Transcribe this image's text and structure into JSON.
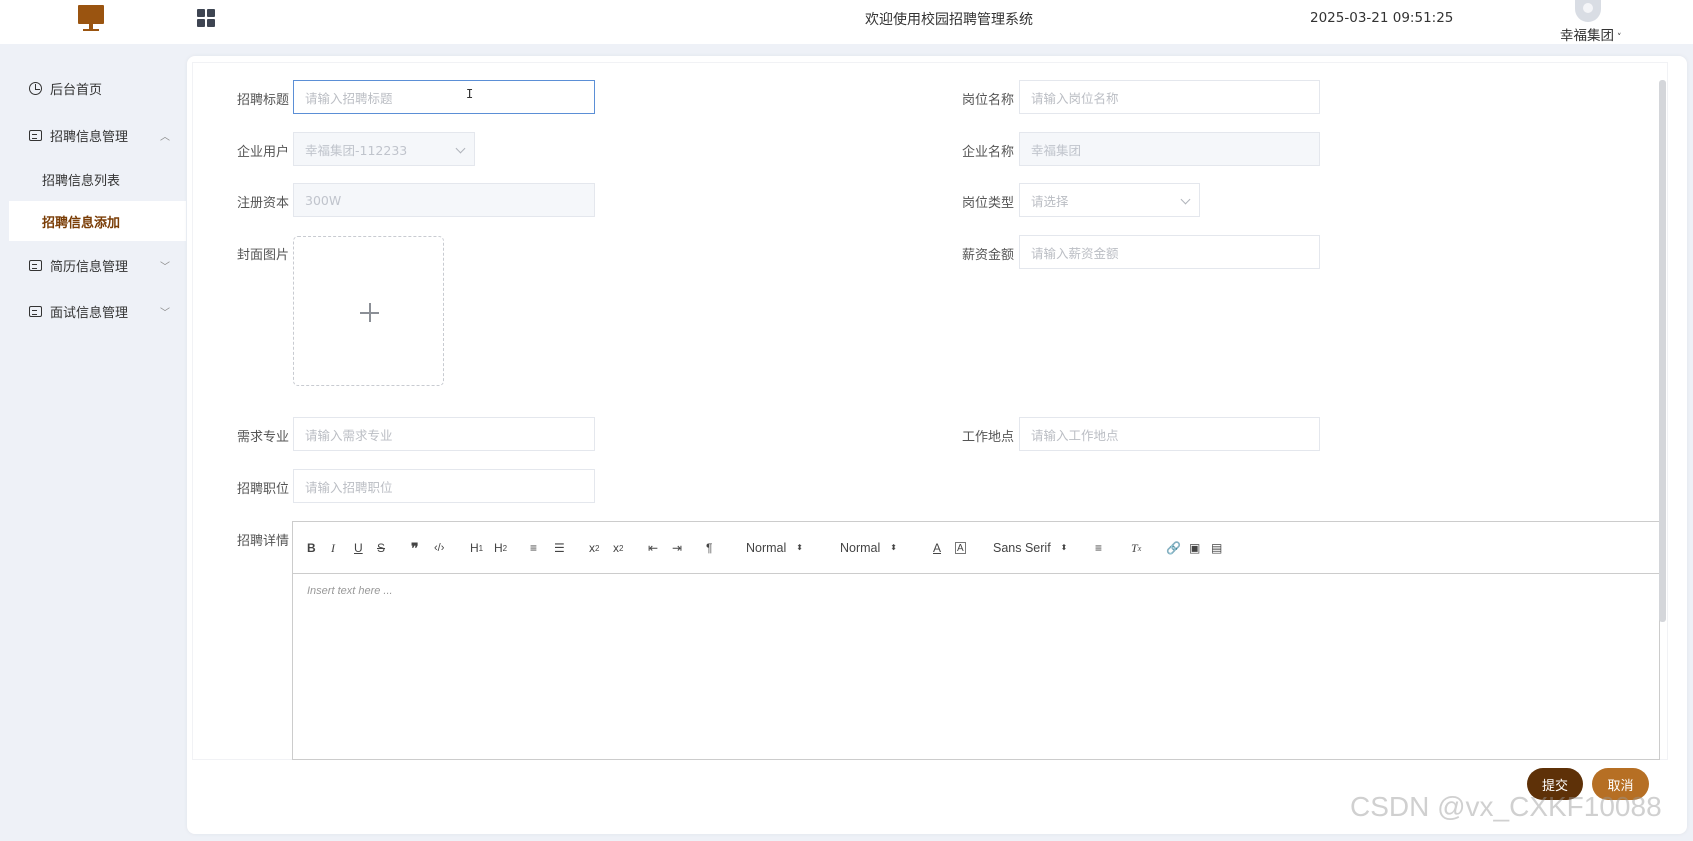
{
  "header": {
    "title": "欢迎使用校园招聘管理系统",
    "datetime": "2025-03-21 09:51:25",
    "user": "幸福集团"
  },
  "sidebar": {
    "items": [
      {
        "label": "后台首页"
      },
      {
        "label": "招聘信息管理",
        "expanded": true,
        "children": [
          {
            "label": "招聘信息列表"
          },
          {
            "label": "招聘信息添加",
            "active": true
          }
        ]
      },
      {
        "label": "简历信息管理"
      },
      {
        "label": "面试信息管理"
      }
    ]
  },
  "form": {
    "title_label": "招聘标题",
    "title_placeholder": "请输入招聘标题",
    "position_name_label": "岗位名称",
    "position_name_placeholder": "请输入岗位名称",
    "company_user_label": "企业用户",
    "company_user_value": "幸福集团-112233",
    "company_name_label": "企业名称",
    "company_name_value": "幸福集团",
    "capital_label": "注册资本",
    "capital_value": "300W",
    "position_type_label": "岗位类型",
    "position_type_placeholder": "请选择",
    "cover_label": "封面图片",
    "salary_label": "薪资金额",
    "salary_placeholder": "请输入薪资金额",
    "major_label": "需求专业",
    "major_placeholder": "请输入需求专业",
    "location_label": "工作地点",
    "location_placeholder": "请输入工作地点",
    "job_label": "招聘职位",
    "job_placeholder": "请输入招聘职位",
    "detail_label": "招聘详情"
  },
  "editor": {
    "placeholder": "Insert text here ...",
    "header_select": "Normal",
    "size_select": "Normal",
    "font_select": "Sans Serif"
  },
  "buttons": {
    "submit": "提交",
    "cancel": "取消"
  },
  "watermark": "CSDN @vx_CXKF10088",
  "colors": {
    "accent": "#5e3108",
    "secondary": "#b66f24",
    "active_menu": "#7a3d06",
    "logo": "#9a5410"
  }
}
